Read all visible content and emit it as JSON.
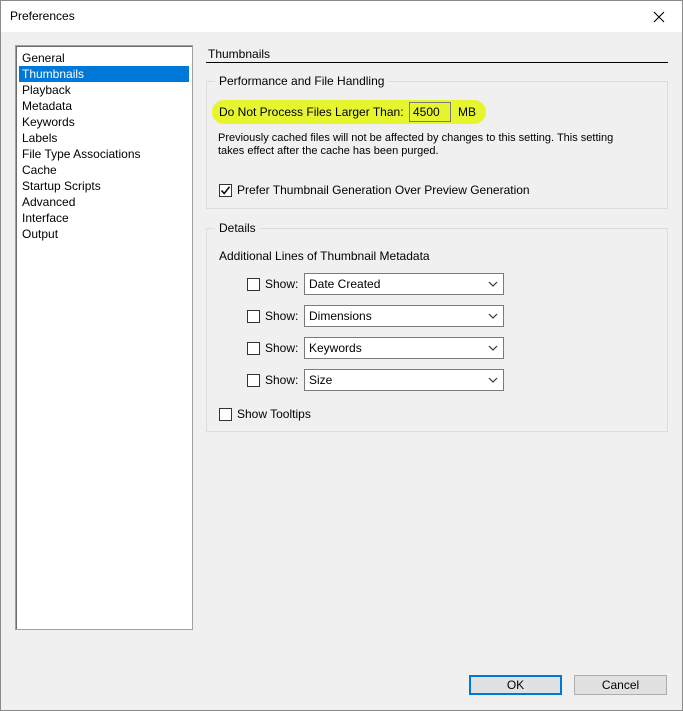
{
  "window": {
    "title": "Preferences"
  },
  "sidebar": {
    "items": [
      {
        "label": "General"
      },
      {
        "label": "Thumbnails",
        "selected": true
      },
      {
        "label": "Playback"
      },
      {
        "label": "Metadata"
      },
      {
        "label": "Keywords"
      },
      {
        "label": "Labels"
      },
      {
        "label": "File Type Associations"
      },
      {
        "label": "Cache"
      },
      {
        "label": "Startup Scripts"
      },
      {
        "label": "Advanced"
      },
      {
        "label": "Interface"
      },
      {
        "label": "Output"
      }
    ]
  },
  "main": {
    "section_title": "Thumbnails",
    "performance": {
      "legend": "Performance and File Handling",
      "max_size_label": "Do Not Process Files Larger Than:",
      "max_size_value": "4500",
      "max_size_unit": "MB",
      "note_line1": "Previously cached files will not be affected by changes to this setting. This setting",
      "note_line2": "takes effect after the cache has been purged.",
      "prefer_label": "Prefer Thumbnail Generation Over Preview Generation",
      "prefer_checked": true
    },
    "details": {
      "legend": "Details",
      "additional_label": "Additional Lines of Thumbnail Metadata",
      "show_label": "Show:",
      "rows": [
        {
          "checked": false,
          "selected": "Date Created"
        },
        {
          "checked": false,
          "selected": "Dimensions"
        },
        {
          "checked": false,
          "selected": "Keywords"
        },
        {
          "checked": false,
          "selected": "Size"
        }
      ],
      "tooltips_label": "Show Tooltips",
      "tooltips_checked": false
    }
  },
  "buttons": {
    "ok": "OK",
    "cancel": "Cancel"
  },
  "colors": {
    "selection": "#0078d7",
    "highlight": "#e7f52f"
  }
}
